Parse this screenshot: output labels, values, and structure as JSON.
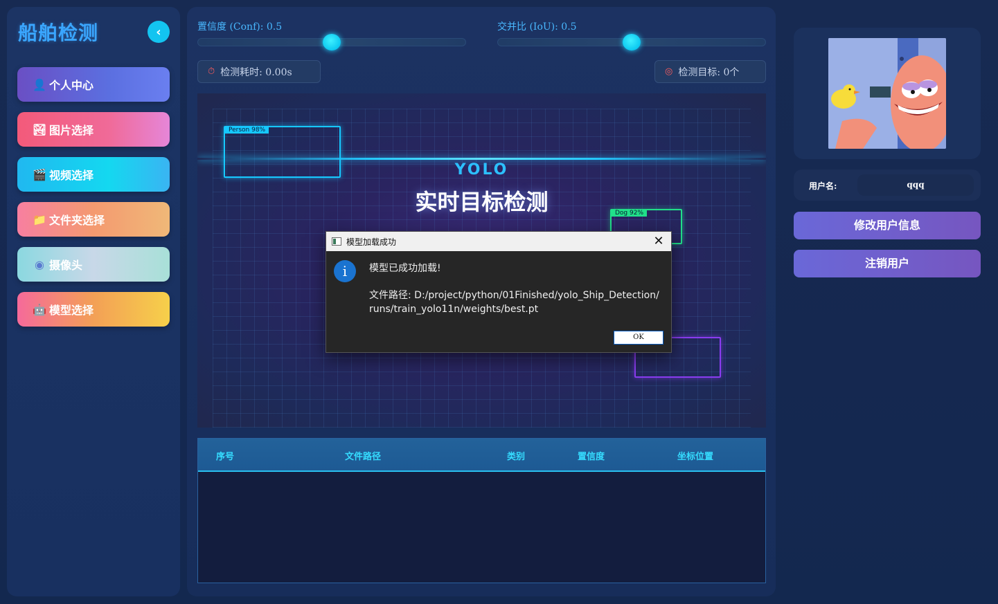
{
  "app": {
    "title": "船舶检测"
  },
  "sidebar": {
    "collapse_icon": "chevron-left-icon",
    "items": [
      {
        "label": "个人中心",
        "icon": "user-icon",
        "glyph": "👤"
      },
      {
        "label": "图片选择",
        "icon": "image-icon",
        "glyph": "🏞"
      },
      {
        "label": "视频选择",
        "icon": "clapper-icon",
        "glyph": "🎬"
      },
      {
        "label": "文件夹选择",
        "icon": "folder-icon",
        "glyph": "📁"
      },
      {
        "label": "摄像头",
        "icon": "webcam-icon",
        "glyph": "◉"
      },
      {
        "label": "模型选择",
        "icon": "robot-icon",
        "glyph": "🤖"
      }
    ]
  },
  "controls": {
    "conf_label": "置信度 (Conf): 0.5",
    "conf_value": 0.5,
    "iou_label": "交并比 (IoU): 0.5",
    "iou_value": 0.5,
    "time_label": "检测耗时: 0.00s",
    "targets_label": "检测目标: 0个"
  },
  "preview": {
    "brand": "YOLO",
    "headline": "实时目标检测",
    "boxes": [
      {
        "label": "Person 98%",
        "color": "#16c8ff"
      },
      {
        "label": "Dog 92%",
        "color": "#21e08a"
      },
      {
        "label": "",
        "color": "#8a3cf0"
      }
    ]
  },
  "table": {
    "columns": [
      "序号",
      "文件路径",
      "类别",
      "置信度",
      "坐标位置"
    ],
    "rows": []
  },
  "user": {
    "name_label": "用户名:",
    "name_value": "qqq",
    "edit_button": "修改用户信息",
    "logout_button": "注销用户"
  },
  "dialog": {
    "title": "模型加载成功",
    "message": "模型已成功加载!",
    "path_line1": "文件路径: D:/project/python/01Finished/yolo_Ship_Detection/",
    "path_line2": "runs/train_yolo11n/weights/best.pt",
    "ok_label": "OK"
  },
  "colors": {
    "accent": "#13c4f0",
    "header_text": "#35dcff",
    "button_purple": "#6a68d8"
  }
}
